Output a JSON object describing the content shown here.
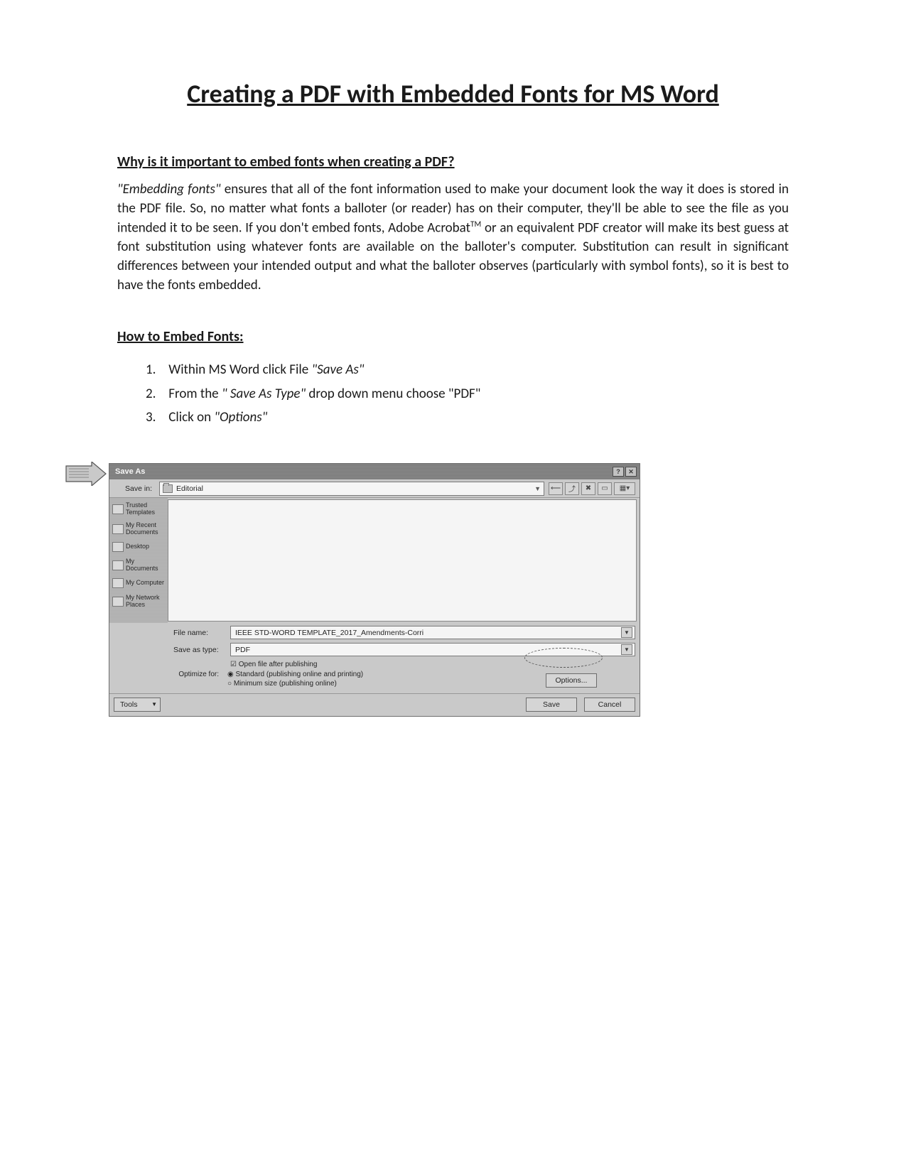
{
  "title": "Creating a PDF with Embedded Fonts for MS Word",
  "section1_heading": "Why is it important to embed fonts when creating a PDF?",
  "body_lead_italic": "\"Embedding fonts\"",
  "body_rest_1": " ensures that all of the font information used to make your document look the way it does is stored in the PDF file. So,  no matter what fonts a balloter (or reader) has on their computer, they'll be able to see the file as you intended it to be seen. If you don't embed fonts, Adobe Acrobat",
  "body_tm": "TM",
  "body_rest_2": " or an equivalent PDF creator will make its best guess at font substitution using whatever fonts are available on the balloter's computer. Substitution can result in significant differences between your intended output and what the balloter observes (particularly with symbol fonts), so it is best to have the fonts embedded.",
  "section2_heading": "How to Embed Fonts:",
  "steps": [
    {
      "num": "1.",
      "pre": "Within MS Word click File ",
      "ital": "\"Save As\"",
      "post": ""
    },
    {
      "num": "2.",
      "pre": "From the ",
      "ital": "\" Save As Type\"",
      "post": " drop down menu choose \"PDF\""
    },
    {
      "num": "3.",
      "pre": "Click on ",
      "ital": "\"Options\"",
      "post": ""
    }
  ],
  "dialog": {
    "title": "Save As",
    "save_in_label": "Save in:",
    "save_in_value": "Editorial",
    "places": [
      "Trusted Templates",
      "My Recent Documents",
      "Desktop",
      "My Documents",
      "My Computer",
      "My Network Places"
    ],
    "file_name_label": "File name:",
    "file_name_value": "IEEE STD-WORD TEMPLATE_2017_Amendments-Corri",
    "save_as_type_label": "Save as type:",
    "save_as_type_value": "PDF",
    "open_after": "Open file after publishing",
    "optimize_label": "Optimize for:",
    "opt_standard": "Standard (publishing online and printing)",
    "opt_minimum": "Minimum size (publishing online)",
    "options_btn": "Options...",
    "tools_btn": "Tools",
    "save_btn": "Save",
    "cancel_btn": "Cancel"
  }
}
